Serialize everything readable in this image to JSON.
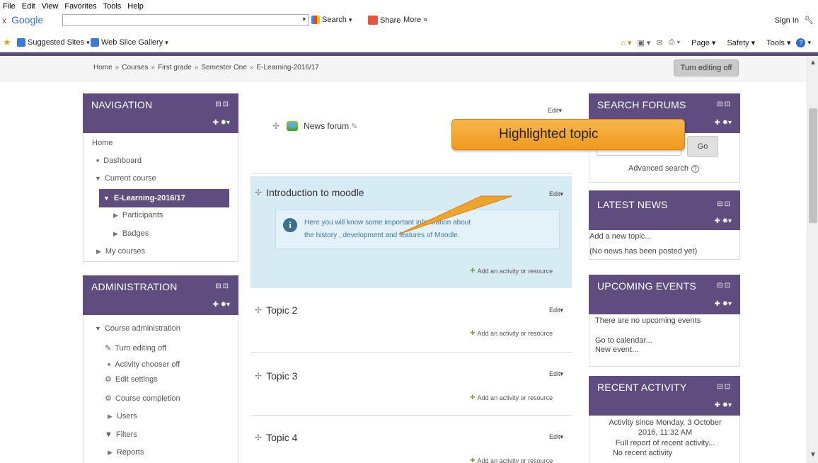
{
  "browser": {
    "menu": [
      "File",
      "Edit",
      "View",
      "Favorites",
      "Tools",
      "Help"
    ],
    "google_logo": "Google",
    "search_label": "Search",
    "share_label": "Share",
    "more_label": "More »",
    "sign_in": "Sign In",
    "favorites": [
      "Suggested Sites",
      "Web Slice Gallery"
    ],
    "commands": [
      "Page",
      "Safety",
      "Tools"
    ]
  },
  "breadcrumb": [
    "Home",
    "Courses",
    "First grade",
    "Semester One",
    "E-Learning-2016/17"
  ],
  "turn_editing_button": "Turn editing off",
  "navigation": {
    "title": "NAVIGATION",
    "items": {
      "home": "Home",
      "dashboard": "Dashboard",
      "current_course": "Current course",
      "course": "E-Learning-2016/17",
      "participants": "Participants",
      "badges": "Badges",
      "my_courses": "My courses"
    }
  },
  "administration": {
    "title": "ADMINISTRATION",
    "items": {
      "course_admin": "Course administration",
      "turn_editing": "Turn editing off",
      "activity_chooser": "Activity chooser off",
      "edit_settings": "Edit settings",
      "course_completion": "Course completion",
      "users": "Users",
      "filters": "Filters",
      "reports": "Reports"
    }
  },
  "center": {
    "edit_label": "Edit",
    "news_forum": "News forum",
    "add_activity": "Add an activity or resource",
    "intro": {
      "title": "Introduction to moodle",
      "info_line1": "Here you will know some important information about",
      "info_line2": "the history , development and features of Moodle."
    },
    "topics": [
      "Topic 2",
      "Topic 3",
      "Topic 4"
    ]
  },
  "callout": "Highlighted topic",
  "search_forums": {
    "title": "SEARCH FORUMS",
    "go": "Go",
    "advanced": "Advanced search"
  },
  "latest_news": {
    "title": "LATEST NEWS",
    "add_topic": "Add a new topic...",
    "no_news": "(No news has been posted yet)"
  },
  "upcoming_events": {
    "title": "UPCOMING EVENTS",
    "none": "There are no upcoming events",
    "calendar": "Go to calendar...",
    "new_event": "New event..."
  },
  "recent_activity": {
    "title": "RECENT ACTIVITY",
    "since_line1": "Activity since Monday, 3 October",
    "since_line2": "2016, 11:32 AM",
    "full_report": "Full report of recent activity...",
    "none": "No recent activity"
  },
  "colors": {
    "block_header": "#5e4d7e",
    "highlight": "#d7ebf4",
    "callout": "#f4a72e"
  }
}
